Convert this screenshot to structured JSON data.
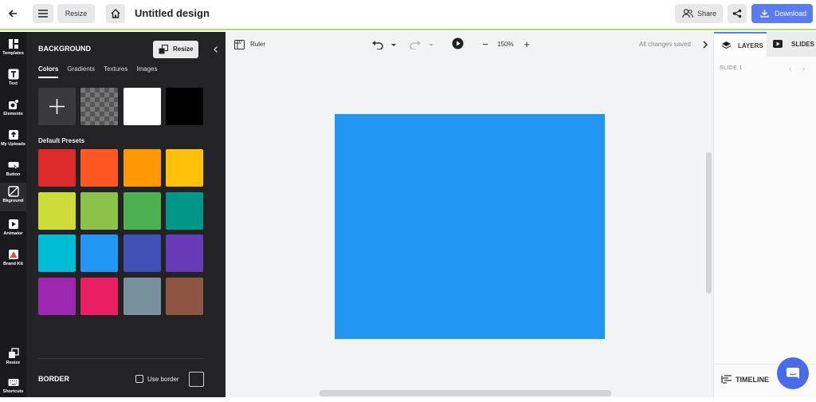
{
  "topbar": {
    "resize_label": "Resize",
    "title": "Untitled design",
    "share_label": "Share",
    "download_label": "Download",
    "download_color": "#5b7cf0"
  },
  "rail": {
    "items": [
      {
        "label": "Templates",
        "icon": "templates-icon"
      },
      {
        "label": "Text",
        "icon": "text-icon"
      },
      {
        "label": "Elements",
        "icon": "elements-icon"
      },
      {
        "label": "My Uploads",
        "icon": "upload-icon"
      },
      {
        "label": "Button",
        "icon": "button-icon"
      },
      {
        "label": "Bkground",
        "icon": "background-icon"
      },
      {
        "label": "Animator",
        "icon": "animator-icon"
      },
      {
        "label": "Brand Kit",
        "icon": "brand-kit-icon"
      }
    ],
    "bottom_items": [
      {
        "label": "Resize",
        "icon": "resize-icon"
      },
      {
        "label": "Shortcuts",
        "icon": "keyboard-icon"
      }
    ]
  },
  "panel": {
    "heading": "BACKGROUND",
    "resize_label": "Resize",
    "tabs": [
      "Colors",
      "Gradients",
      "Textures",
      "Images"
    ],
    "active_tab": "Colors",
    "basic_colors": [
      "add",
      "transparent",
      "#ffffff",
      "#000000"
    ],
    "presets_label": "Default Presets",
    "presets": [
      "#dc2a2a",
      "#ff5722",
      "#ff9800",
      "#ffc107",
      "#cddc39",
      "#8bc34a",
      "#4caf50",
      "#009688",
      "#00bcd4",
      "#2196f3",
      "#3f51b5",
      "#673ab7",
      "#9c27b0",
      "#e91e63",
      "#78909c",
      "#8d5541"
    ],
    "border_heading": "BORDER",
    "use_border_label": "Use border"
  },
  "canvas_toolbar": {
    "ruler_label": "Ruler",
    "zoom_level": "150%",
    "save_status": "All changes saved"
  },
  "canvas": {
    "design_color": "#2196f3"
  },
  "right_panel": {
    "layers_label": "LAYERS",
    "slides_label": "SLIDES",
    "slide_label": "SLIDE 1",
    "timeline_label": "TIMELINE"
  }
}
